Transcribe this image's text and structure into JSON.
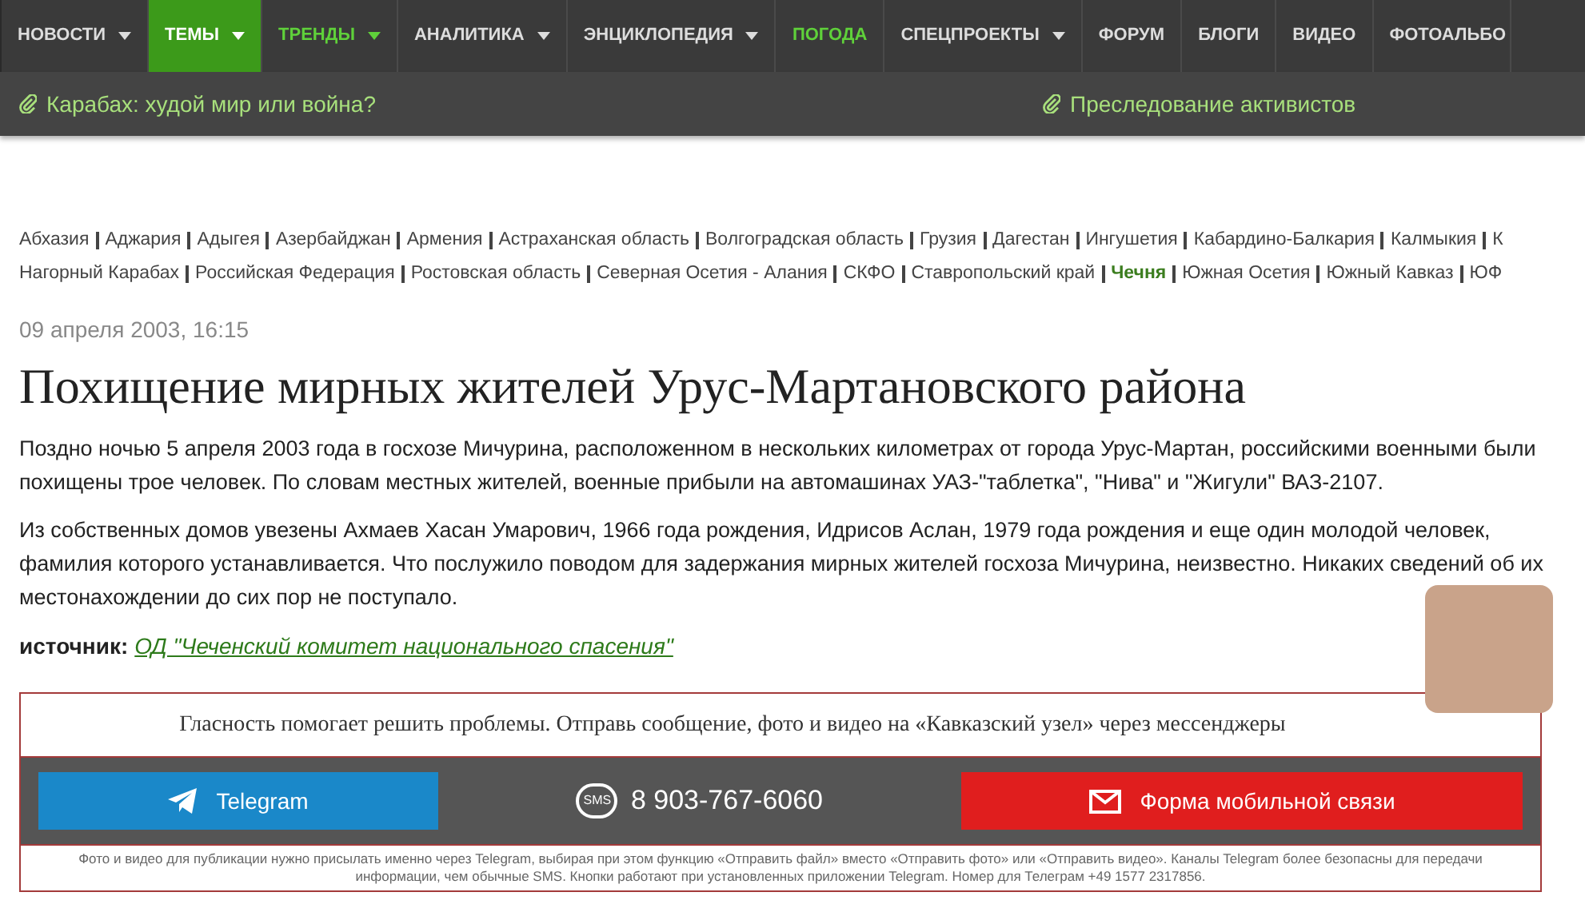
{
  "nav": {
    "items": [
      {
        "label": "НОВОСТИ",
        "dropdown": true,
        "selected": false,
        "accent": false
      },
      {
        "label": "ТЕМЫ",
        "dropdown": true,
        "selected": true,
        "accent": false
      },
      {
        "label": "ТРЕНДЫ",
        "dropdown": true,
        "selected": false,
        "accent": true
      },
      {
        "label": "АНАЛИТИКА",
        "dropdown": true,
        "selected": false,
        "accent": false
      },
      {
        "label": "ЭНЦИКЛОПЕДИЯ",
        "dropdown": true,
        "selected": false,
        "accent": false
      },
      {
        "label": "ПОГОДА",
        "dropdown": false,
        "selected": false,
        "accent": true
      },
      {
        "label": "СПЕЦПРОЕКТЫ",
        "dropdown": true,
        "selected": false,
        "accent": false
      },
      {
        "label": "ФОРУМ",
        "dropdown": false,
        "selected": false,
        "accent": false
      },
      {
        "label": "БЛОГИ",
        "dropdown": false,
        "selected": false,
        "accent": false
      },
      {
        "label": "ВИДЕО",
        "dropdown": false,
        "selected": false,
        "accent": false
      },
      {
        "label": "ФОТОАЛЬБО",
        "dropdown": false,
        "selected": false,
        "accent": false
      }
    ]
  },
  "featured_links": [
    "Карабах: худой мир или война?",
    "Преследование активистов"
  ],
  "regions": [
    [
      {
        "label": "Абхазия",
        "selected": false
      },
      {
        "label": "Аджария",
        "selected": false
      },
      {
        "label": "Адыгея",
        "selected": false
      },
      {
        "label": "Азербайджан",
        "selected": false
      },
      {
        "label": "Армения",
        "selected": false
      },
      {
        "label": "Астраханская область",
        "selected": false
      },
      {
        "label": "Волгоградская область",
        "selected": false
      },
      {
        "label": "Грузия",
        "selected": false
      },
      {
        "label": "Дагестан",
        "selected": false
      },
      {
        "label": "Ингушетия",
        "selected": false
      },
      {
        "label": "Кабардино-Балкария",
        "selected": false
      },
      {
        "label": "Калмыкия",
        "selected": false
      },
      {
        "label": "К",
        "selected": false
      }
    ],
    [
      {
        "label": "Нагорный Карабах",
        "selected": false
      },
      {
        "label": "Российская Федерация",
        "selected": false
      },
      {
        "label": "Ростовская область",
        "selected": false
      },
      {
        "label": "Северная Осетия - Алания",
        "selected": false
      },
      {
        "label": "СКФО",
        "selected": false
      },
      {
        "label": "Ставропольский край",
        "selected": false
      },
      {
        "label": "Чечня",
        "selected": true
      },
      {
        "label": "Южная Осетия",
        "selected": false
      },
      {
        "label": "Южный Кавказ",
        "selected": false
      },
      {
        "label": "ЮФ",
        "selected": false
      }
    ]
  ],
  "article": {
    "date": "09 апреля 2003, 16:15",
    "title": "Похищение мирных жителей Урус-Мартановского района",
    "paragraphs": [
      "Поздно ночью 5 апреля 2003 года в госхозе Мичурина, расположенном в нескольких километрах от города Урус-Мартан, российскими военными были похищены трое человек. По словам местных жителей, военные прибыли на автомашинах УАЗ-\"таблетка\", \"Нива\" и \"Жигули\" ВАЗ-2107.",
      "Из собственных домов увезены Ахмаев Хасан Умарович, 1966 года рождения, Идрисов Аслан, 1979 года рождения и еще один молодой человек, фамилия которого устанавливается. Что послужило поводом для задержания мирных жителей госхоза Мичурина, неизвестно. Никаких сведений об их местонахождении до сих пор не поступало."
    ],
    "source_label": "источник:",
    "source_link": "ОД \"Чеченский комитет национального спасения\""
  },
  "contact": {
    "heading": "Гласность помогает решить проблемы. Отправь сообщение, фото и видео на «Кавказский узел» через мессенджеры",
    "telegram": "Telegram",
    "sms_badge": "SMS",
    "phone": "8 903-767-6060",
    "form": "Форма мобильной связи",
    "note": "Фото и видео для публикации нужно присылать именно через Telegram, выбирая при этом функцию «Отправить файл» вместо «Отправить фото» или «Отправить видео». Каналы Telegram более безопасны для передачи информации, чем обычные SMS. Кнопки работают при установленных приложении Telegram. Номер для Телеграм +49 1577 2317856."
  }
}
